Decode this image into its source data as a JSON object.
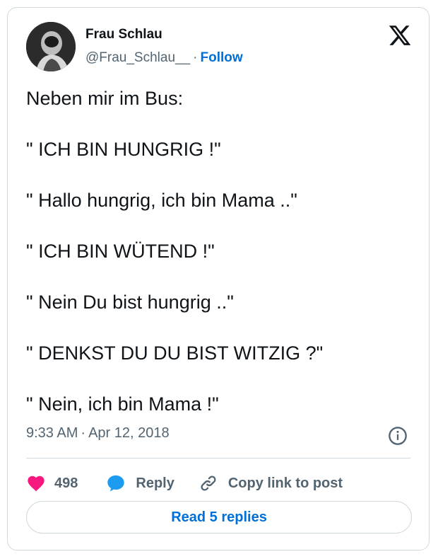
{
  "author": {
    "display_name": "Frau Schlau",
    "handle": "@Frau_Schlau__",
    "separator": "·",
    "follow_label": "Follow"
  },
  "tweet": {
    "text": "Neben mir im Bus:\n\n\" ICH BIN HUNGRIG !\"\n\n\" Hallo hungrig, ich bin Mama ..\"\n\n\" ICH BIN WÜTEND !\"\n\n\" Nein Du bist hungrig ..\"\n\n\" DENKST DU DU BIST WITZIG ?\"\n\n\" Nein, ich bin Mama !\""
  },
  "meta": {
    "time": "9:33 AM",
    "separator": "·",
    "date": "Apr 12, 2018"
  },
  "actions": {
    "like_count": "498",
    "reply_label": "Reply",
    "copy_label": "Copy link to post"
  },
  "read_replies_label": "Read 5 replies",
  "icons": {
    "brand": "x-logo-icon",
    "like": "heart-icon",
    "reply": "speech-bubble-icon",
    "copy": "link-icon",
    "info": "info-icon"
  },
  "colors": {
    "accent": "#006fd6",
    "like": "#f91880",
    "reply": "#1d9bf0",
    "muted": "#536471",
    "border": "#cfd9de"
  }
}
